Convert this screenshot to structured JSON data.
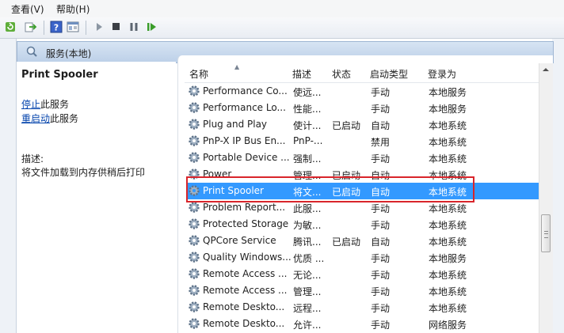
{
  "menu": {
    "view": "查看(V)",
    "help": "帮助(H)"
  },
  "header": {
    "title": "服务(本地)"
  },
  "left_pane": {
    "service_name": "Print Spooler",
    "stop_link": "停止",
    "stop_suffix": "此服务",
    "restart_link": "重启动",
    "restart_suffix": "此服务",
    "description_label": "描述:",
    "description": "将文件加载到内存供稍后打印"
  },
  "columns": {
    "name": "名称",
    "desc": "描述",
    "status": "状态",
    "startup": "启动类型",
    "logon": "登录为"
  },
  "rows": [
    {
      "name": "Performance Co...",
      "desc": "使远...",
      "status": "",
      "startup": "手动",
      "logon": "本地服务"
    },
    {
      "name": "Performance Lo...",
      "desc": "性能...",
      "status": "",
      "startup": "手动",
      "logon": "本地服务"
    },
    {
      "name": "Plug and Play",
      "desc": "使计...",
      "status": "已启动",
      "startup": "自动",
      "logon": "本地系统"
    },
    {
      "name": "PnP-X IP Bus En...",
      "desc": "PnP-...",
      "status": "",
      "startup": "禁用",
      "logon": "本地系统"
    },
    {
      "name": "Portable Device ...",
      "desc": "强制...",
      "status": "",
      "startup": "手动",
      "logon": "本地系统"
    },
    {
      "name": "Power",
      "desc": "管理...",
      "status": "已启动",
      "startup": "自动",
      "logon": "本地系统"
    },
    {
      "name": "Print Spooler",
      "desc": "将文...",
      "status": "已启动",
      "startup": "自动",
      "logon": "本地系统"
    },
    {
      "name": "Problem Report...",
      "desc": "此服...",
      "status": "",
      "startup": "手动",
      "logon": "本地系统"
    },
    {
      "name": "Protected Storage",
      "desc": "为敏...",
      "status": "",
      "startup": "手动",
      "logon": "本地系统"
    },
    {
      "name": "QPCore Service",
      "desc": "腾讯...",
      "status": "已启动",
      "startup": "自动",
      "logon": "本地系统"
    },
    {
      "name": "Quality Windows...",
      "desc": "优质 ...",
      "status": "",
      "startup": "手动",
      "logon": "本地服务"
    },
    {
      "name": "Remote Access ...",
      "desc": "无论...",
      "status": "",
      "startup": "手动",
      "logon": "本地系统"
    },
    {
      "name": "Remote Access ...",
      "desc": "管理...",
      "status": "",
      "startup": "手动",
      "logon": "本地系统"
    },
    {
      "name": "Remote Deskto...",
      "desc": "远程...",
      "status": "",
      "startup": "手动",
      "logon": "本地系统"
    },
    {
      "name": "Remote Deskto...",
      "desc": "允许...",
      "status": "",
      "startup": "手动",
      "logon": "网络服务"
    }
  ],
  "icons": {
    "refresh": "refresh-icon",
    "export": "export-list-icon",
    "help": "help-icon",
    "properties": "properties-icon",
    "start": "start-icon",
    "stop": "stop-icon",
    "pause": "pause-icon",
    "restart": "restart-icon",
    "gear": "service-gear-icon"
  },
  "colors": {
    "selection": "#3399ff",
    "highlight_box": "#d9252b",
    "link": "#0645ad"
  }
}
